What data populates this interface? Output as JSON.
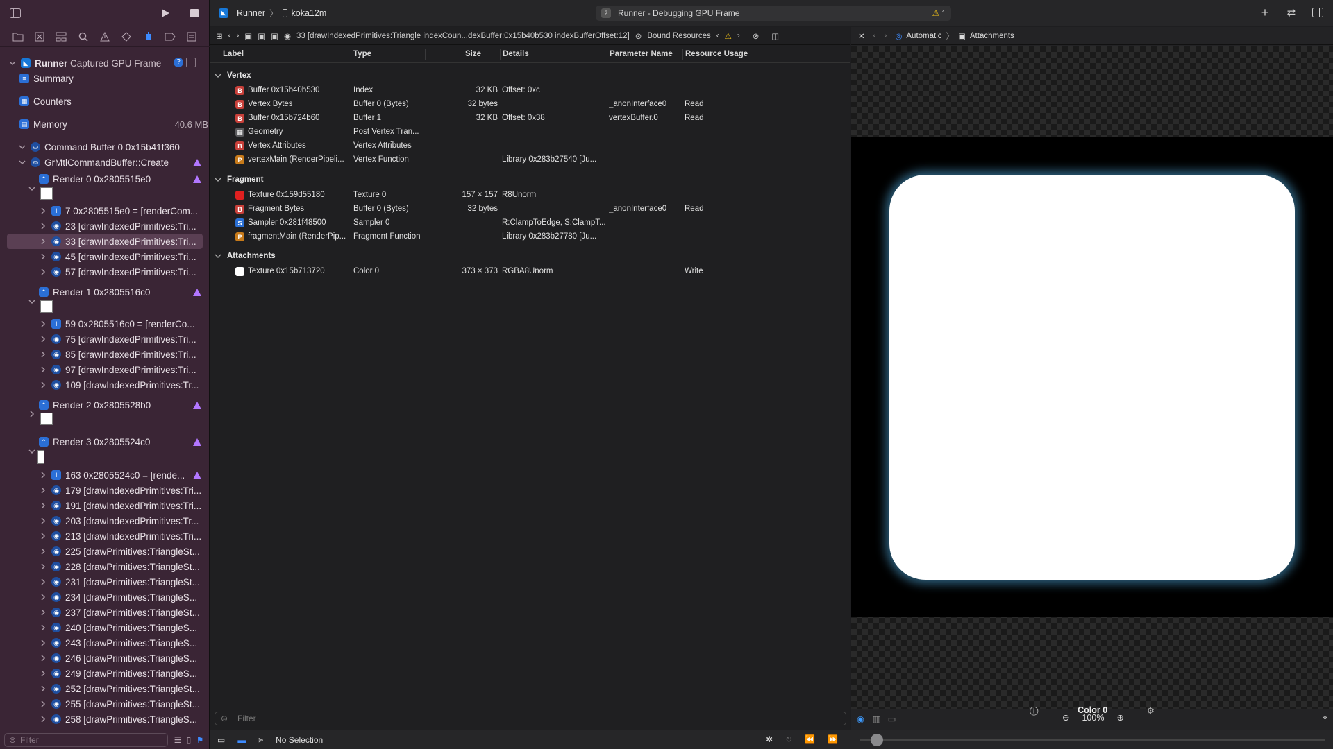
{
  "app": {
    "scheme": "Runner",
    "device": "koka12m"
  },
  "activity": {
    "badge": "2",
    "text": "Runner - Debugging GPU Frame",
    "warnings": "1"
  },
  "sidebar": {
    "root": {
      "name": "Runner",
      "subtitle": "Captured GPU Frame"
    },
    "summary": "Summary",
    "counters": "Counters",
    "memory": {
      "label": "Memory",
      "value": "40.6 MB"
    },
    "command_buffer": "Command Buffer 0 0x15b41f360",
    "create": "GrMtlCommandBuffer::Create",
    "items": [
      {
        "label": "Render 0 0x2805515e0"
      },
      {
        "label": "7 0x2805515e0 = [renderCom..."
      },
      {
        "label": "23 [drawIndexedPrimitives:Tri..."
      },
      {
        "label": "33 [drawIndexedPrimitives:Tri..."
      },
      {
        "label": "45 [drawIndexedPrimitives:Tri..."
      },
      {
        "label": "57 [drawIndexedPrimitives:Tri..."
      },
      {
        "label": "Render 1 0x2805516c0"
      },
      {
        "label": "59 0x2805516c0 = [renderCo..."
      },
      {
        "label": "75 [drawIndexedPrimitives:Tri..."
      },
      {
        "label": "85 [drawIndexedPrimitives:Tri..."
      },
      {
        "label": "97 [drawIndexedPrimitives:Tri..."
      },
      {
        "label": "109 [drawIndexedPrimitives:Tr..."
      },
      {
        "label": "Render 2 0x2805528b0"
      },
      {
        "label": "Render 3 0x2805524c0"
      },
      {
        "label": "163 0x2805524c0 = [rende..."
      },
      {
        "label": "179 [drawIndexedPrimitives:Tri..."
      },
      {
        "label": "191 [drawIndexedPrimitives:Tri..."
      },
      {
        "label": "203 [drawIndexedPrimitives:Tr..."
      },
      {
        "label": "213 [drawIndexedPrimitives:Tri..."
      },
      {
        "label": "225 [drawPrimitives:TriangleSt..."
      },
      {
        "label": "228 [drawPrimitives:TriangleSt..."
      },
      {
        "label": "231 [drawPrimitives:TriangleSt..."
      },
      {
        "label": "234 [drawPrimitives:TriangleS..."
      },
      {
        "label": "237 [drawPrimitives:TriangleSt..."
      },
      {
        "label": "240 [drawPrimitives:TriangleS..."
      },
      {
        "label": "243 [drawPrimitives:TriangleS..."
      },
      {
        "label": "246 [drawPrimitives:TriangleS..."
      },
      {
        "label": "249 [drawPrimitives:TriangleS..."
      },
      {
        "label": "252 [drawPrimitives:TriangleSt..."
      },
      {
        "label": "255 [drawPrimitives:TriangleSt..."
      },
      {
        "label": "258 [drawPrimitives:TriangleS..."
      }
    ],
    "filter_placeholder": "Filter"
  },
  "jumpbar": {
    "path": "33 [drawIndexedPrimitives:Triangle indexCoun...dexBuffer:0x15b40b530 indexBufferOffset:12]",
    "bound": "Bound Resources"
  },
  "table": {
    "columns": [
      "Label",
      "Type",
      "Size",
      "Details",
      "Parameter Name",
      "Resource Usage"
    ],
    "sections": [
      {
        "name": "Vertex",
        "rows": [
          {
            "badge": "B",
            "label": "Buffer 0x15b40b530",
            "type": "Index",
            "size": "32 KB",
            "details": "Offset: 0xc",
            "param": "",
            "usage": ""
          },
          {
            "badge": "B",
            "label": "Vertex Bytes",
            "type": "Buffer 0 (Bytes)",
            "size": "32 bytes",
            "details": "",
            "param": "_anonInterface0",
            "usage": "Read"
          },
          {
            "badge": "B",
            "label": "Buffer 0x15b724b60",
            "type": "Buffer 1",
            "size": "32 KB",
            "details": "Offset: 0x38",
            "param": "vertexBuffer.0",
            "usage": "Read"
          },
          {
            "badge": "",
            "label": "Geometry",
            "type": "Post Vertex Tran...",
            "size": "",
            "details": "",
            "param": "",
            "usage": ""
          },
          {
            "badge": "B",
            "label": "Vertex Attributes",
            "type": "Vertex Attributes",
            "size": "",
            "details": "",
            "param": "",
            "usage": ""
          },
          {
            "badge": "P",
            "label": "vertexMain (RenderPipeli...",
            "type": "Vertex Function",
            "size": "",
            "details": "Library 0x283b27540 [Ju...",
            "param": "",
            "usage": ""
          }
        ]
      },
      {
        "name": "Fragment",
        "rows": [
          {
            "badge": "",
            "label": "Texture 0x159d55180",
            "type": "Texture 0",
            "size": "157 × 157",
            "details": "R8Unorm",
            "param": "",
            "usage": ""
          },
          {
            "badge": "B",
            "label": "Fragment Bytes",
            "type": "Buffer 0 (Bytes)",
            "size": "32 bytes",
            "details": "",
            "param": "_anonInterface0",
            "usage": "Read"
          },
          {
            "badge": "S",
            "label": "Sampler 0x281f48500",
            "type": "Sampler 0",
            "size": "",
            "details": "R:ClampToEdge, S:ClampT...",
            "param": "",
            "usage": ""
          },
          {
            "badge": "P",
            "label": "fragmentMain (RenderPip...",
            "type": "Fragment Function",
            "size": "",
            "details": "Library 0x283b27780 [Ju...",
            "param": "",
            "usage": ""
          }
        ]
      },
      {
        "name": "Attachments",
        "rows": [
          {
            "badge": "",
            "label": "Texture 0x15b713720",
            "type": "Color 0",
            "size": "373 × 373",
            "details": "RGBA8Unorm",
            "param": "",
            "usage": "Write"
          }
        ]
      }
    ],
    "filter_placeholder": "Filter"
  },
  "preview": {
    "crumb_auto": "Automatic",
    "crumb_attach": "Attachments",
    "image_label": "Color 0",
    "zoom": "100%"
  },
  "status": {
    "selection": "No Selection"
  },
  "colors": {
    "accent": "#3d8bff",
    "sidebar_bg": "#3a2535",
    "warning": "#f5c518",
    "purple": "#b277ff"
  }
}
